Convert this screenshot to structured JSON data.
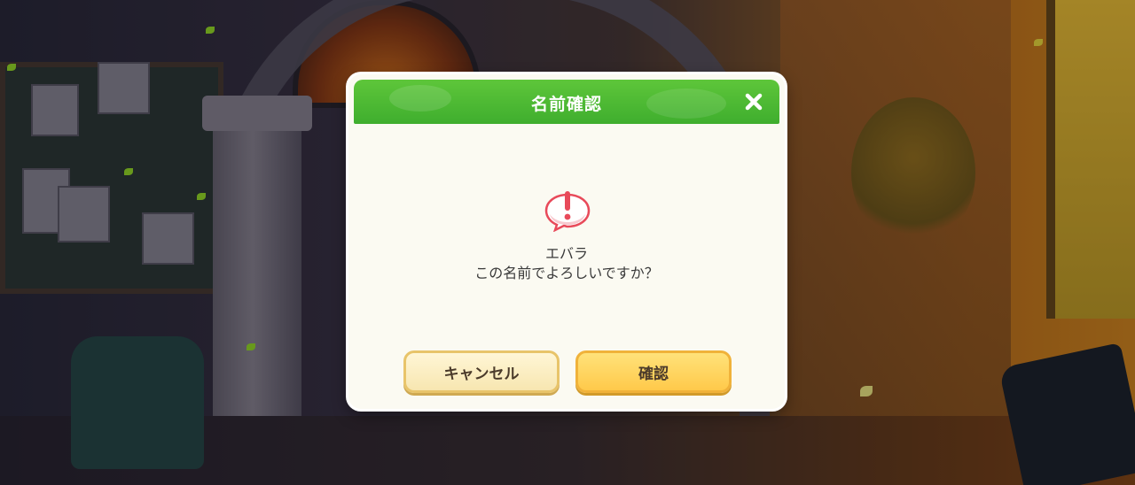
{
  "dialog": {
    "title": "名前確認",
    "name": "エバラ",
    "question": "この名前でよろしいですか？",
    "cancel_label": "キャンセル",
    "confirm_label": "確認"
  },
  "icons": {
    "close": "close-icon",
    "alert": "exclamation-speech-bubble-icon"
  },
  "colors": {
    "header_green": "#4ab834",
    "dialog_bg": "#fbfaf2",
    "confirm_button": "#ffd35a",
    "cancel_button": "#fff3cf",
    "alert_red": "#e84a5a"
  }
}
